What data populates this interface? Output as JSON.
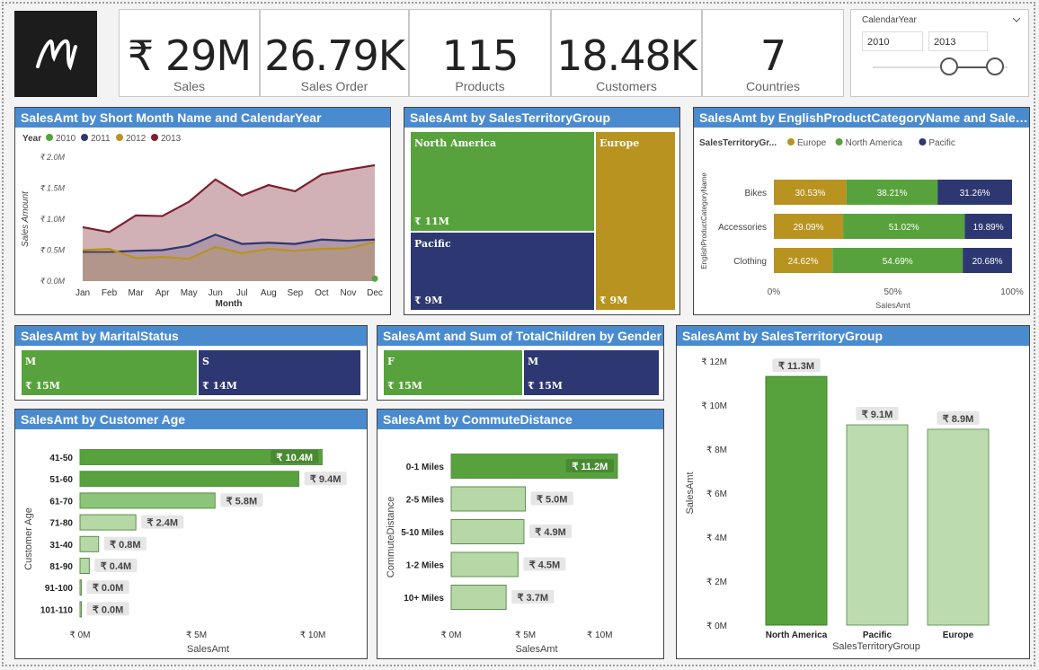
{
  "kpis": [
    {
      "value": "₹ 29M",
      "label": "Sales"
    },
    {
      "value": "26.79K",
      "label": "Sales Order"
    },
    {
      "value": "115",
      "label": "Products"
    },
    {
      "value": "18.48K",
      "label": "Customers"
    },
    {
      "value": "7",
      "label": "Countries"
    }
  ],
  "slicer": {
    "title": "CalendarYear",
    "from": "2010",
    "to": "2013",
    "range": [
      2010,
      2013
    ]
  },
  "colors": {
    "green": "#57a23c",
    "navy": "#2d3771",
    "gold": "#b89320",
    "maroon": "#7d1f2e",
    "light_green": "#bcdcb0",
    "header": "#4a8bd0"
  },
  "titles": {
    "month_chart": "SalesAmt by Short Month Name and CalendarYear",
    "territory_treemap": "SalesAmt by SalesTerritoryGroup",
    "category_chart": "SalesAmt by EnglishProductCategoryName and SalesTerritoryGroup",
    "marital": "SalesAmt by MaritalStatus",
    "gender": "SalesAmt and Sum of TotalChildren by Gender",
    "territory_bar": "SalesAmt by SalesTerritoryGroup",
    "age": "SalesAmt by Customer Age",
    "commute": "SalesAmt by CommuteDistance"
  },
  "territory_treemap": [
    {
      "name": "North America",
      "amount": "₹ 11M"
    },
    {
      "name": "Europe",
      "amount": "₹ 9M"
    },
    {
      "name": "Pacific",
      "amount": "₹ 9M"
    }
  ],
  "marital": [
    {
      "name": "M",
      "amount": "₹ 15M"
    },
    {
      "name": "S",
      "amount": "₹ 14M"
    }
  ],
  "gender": [
    {
      "name": "F",
      "amount": "₹ 15M"
    },
    {
      "name": "M",
      "amount": "₹ 15M"
    }
  ],
  "chart_data": [
    {
      "type": "area",
      "title": "SalesAmt by Short Month Name and CalendarYear",
      "legend_title": "Year",
      "xlabel": "Month",
      "ylabel": "Sales Amount",
      "categories": [
        "Jan",
        "Feb",
        "Mar",
        "Apr",
        "May",
        "Jun",
        "Jul",
        "Aug",
        "Sep",
        "Oct",
        "Nov",
        "Dec"
      ],
      "yticks": [
        "₹ 0.0M",
        "₹ 0.5M",
        "₹ 1.0M",
        "₹ 1.5M",
        "₹ 2.0M"
      ],
      "ylim": [
        0,
        2.0
      ],
      "series": [
        {
          "name": "2010",
          "color": "#57a23c",
          "values": [
            null,
            null,
            null,
            null,
            null,
            null,
            null,
            null,
            null,
            null,
            null,
            0.04
          ]
        },
        {
          "name": "2011",
          "color": "#2d3771",
          "values": [
            0.47,
            0.47,
            0.49,
            0.5,
            0.57,
            0.75,
            0.6,
            0.62,
            0.6,
            0.67,
            0.65,
            0.67
          ]
        },
        {
          "name": "2012",
          "color": "#b89320",
          "values": [
            0.5,
            0.52,
            0.37,
            0.39,
            0.36,
            0.55,
            0.45,
            0.52,
            0.49,
            0.52,
            0.53,
            0.63
          ]
        },
        {
          "name": "2013",
          "color": "#7d1f2e",
          "values": [
            0.87,
            0.79,
            1.06,
            1.05,
            1.28,
            1.64,
            1.38,
            1.55,
            1.45,
            1.72,
            1.8,
            1.87
          ]
        }
      ]
    },
    {
      "type": "bar",
      "orientation": "horizontal-stacked-100",
      "title": "SalesAmt by EnglishProductCategoryName and SalesTerritoryGroup",
      "legend_title": "SalesTerritoryGr...",
      "xlabel": "SalesAmt",
      "ylabel": "EnglishProductCategoryName",
      "categories": [
        "Bikes",
        "Accessories",
        "Clothing"
      ],
      "xticks": [
        "0%",
        "50%",
        "100%"
      ],
      "series": [
        {
          "name": "Europe",
          "color": "#b89320",
          "values": [
            30.53,
            29.09,
            24.62
          ]
        },
        {
          "name": "North America",
          "color": "#57a23c",
          "values": [
            38.21,
            51.02,
            54.69
          ]
        },
        {
          "name": "Pacific",
          "color": "#2d3771",
          "values": [
            31.26,
            19.89,
            20.68
          ]
        }
      ],
      "labels": [
        [
          "30.53%",
          "38.21%",
          "31.26%"
        ],
        [
          "29.09%",
          "51.02%",
          "19.89%"
        ],
        [
          "24.62%",
          "54.69%",
          "20.68%"
        ]
      ]
    },
    {
      "type": "bar",
      "orientation": "vertical",
      "title": "SalesAmt by SalesTerritoryGroup",
      "xlabel": "SalesTerritoryGroup",
      "ylabel": "SalesAmt",
      "categories": [
        "North America",
        "Pacific",
        "Europe"
      ],
      "values": [
        11.3,
        9.1,
        8.9
      ],
      "labels": [
        "₹ 11.3M",
        "₹ 9.1M",
        "₹ 8.9M"
      ],
      "yticks": [
        "₹ 0M",
        "₹ 2M",
        "₹ 4M",
        "₹ 6M",
        "₹ 8M",
        "₹ 10M",
        "₹ 12M"
      ],
      "ylim": [
        0,
        12
      ]
    },
    {
      "type": "bar",
      "orientation": "horizontal",
      "title": "SalesAmt by Customer Age",
      "xlabel": "SalesAmt",
      "ylabel": "Customer Age",
      "categories": [
        "41-50",
        "51-60",
        "61-70",
        "71-80",
        "31-40",
        "81-90",
        "91-100",
        "101-110"
      ],
      "values": [
        10.4,
        9.4,
        5.8,
        2.4,
        0.8,
        0.4,
        0.0,
        0.0
      ],
      "labels": [
        "₹ 10.4M",
        "₹ 9.4M",
        "₹ 5.8M",
        "₹ 2.4M",
        "₹ 0.8M",
        "₹ 0.4M",
        "₹ 0.0M",
        "₹ 0.0M"
      ],
      "xticks": [
        "₹ 0M",
        "₹ 5M",
        "₹ 10M"
      ],
      "xlim": [
        0,
        11
      ]
    },
    {
      "type": "bar",
      "orientation": "horizontal",
      "title": "SalesAmt by CommuteDistance",
      "xlabel": "SalesAmt",
      "ylabel": "CommuteDistance",
      "categories": [
        "0-1 Miles",
        "2-5 Miles",
        "5-10 Miles",
        "1-2 Miles",
        "10+ Miles"
      ],
      "values": [
        11.2,
        5.0,
        4.9,
        4.5,
        3.7
      ],
      "labels": [
        "₹ 11.2M",
        "₹ 5.0M",
        "₹ 4.9M",
        "₹ 4.5M",
        "₹ 3.7M"
      ],
      "xticks": [
        "₹ 0M",
        "₹ 5M",
        "₹ 10M"
      ],
      "xlim": [
        0,
        11.5
      ]
    }
  ]
}
